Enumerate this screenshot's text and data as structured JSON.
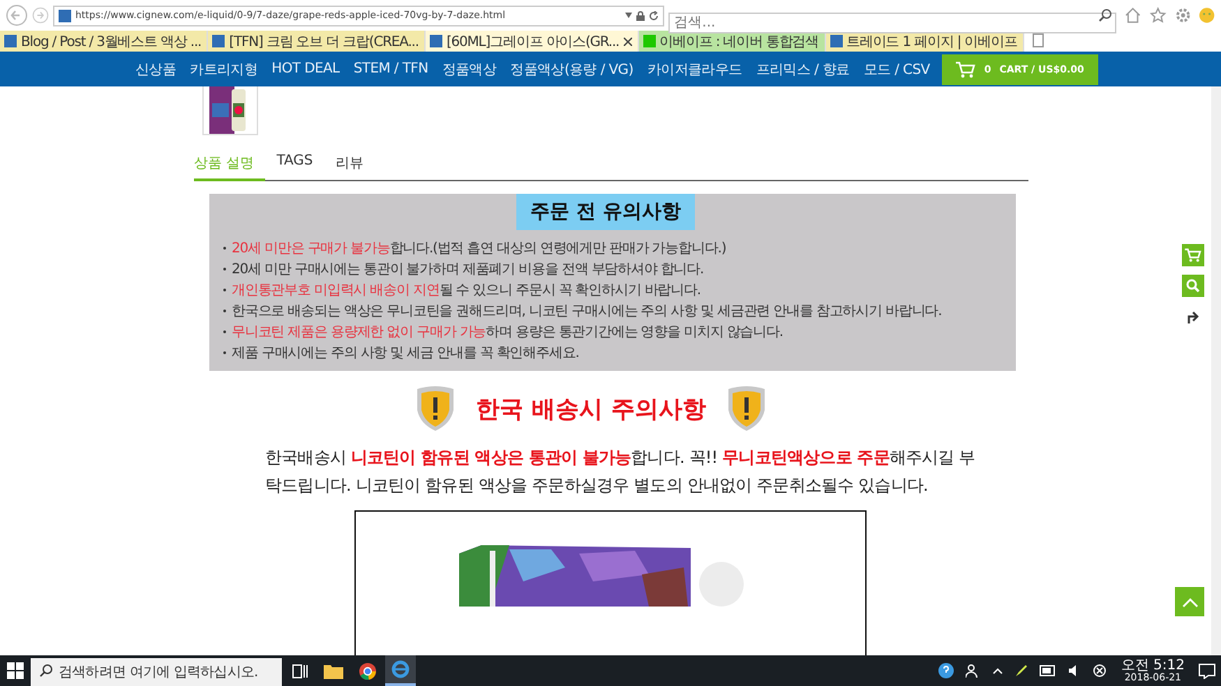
{
  "browser": {
    "address": "https://www.cignew.com/e-liquid/0-9/7-daze/grape-reds-apple-iced-70vg-by-7-daze.html",
    "search": {
      "placeholder": "검색..."
    },
    "tabs": [
      {
        "label": "Blog / Post / 3월베스트 액상 ...",
        "selected": false
      },
      {
        "label": "[TFN] 크림 오브 더 크랍(CREA...",
        "selected": false
      },
      {
        "label": "[60ML]그레이프 아이스(GR...",
        "selected": true
      },
      {
        "label": "이베이프 : 네이버 통합검색",
        "selected": false
      },
      {
        "label": "트레이드 1 페이지 | 이베이프",
        "selected": false
      }
    ]
  },
  "nav": {
    "items": [
      "신상품",
      "카트리지형",
      "HOT DEAL",
      "STEM / TFN",
      "정품액상",
      "정품액상(용량 / VG)",
      "카이저클라우드",
      "프리믹스 / 향료",
      "모드 / CSV"
    ],
    "cart": {
      "count": "0",
      "label": "CART / US$0.00"
    }
  },
  "product_tabs": [
    {
      "label": "상품 설명",
      "selected": true
    },
    {
      "label": "TAGS",
      "selected": false
    },
    {
      "label": "리뷰",
      "selected": false
    }
  ],
  "notice": {
    "title": "주문 전 유의사항",
    "lines": [
      [
        {
          "text": "20세 미만은 구매가 불가능",
          "highlight": true
        },
        {
          "text": "합니다.(법적 흡연 대상의 연령에게만 판매가 가능합니다.)",
          "highlight": false
        }
      ],
      [
        {
          "text": "20세 미만 구매시에는 통관이 불가하며 제품폐기 비용을 전액 부담하셔야 합니다.",
          "highlight": false
        }
      ],
      [
        {
          "text": "개인통관부호 미입력시 배송이 지연",
          "highlight": true
        },
        {
          "text": "될 수 있으니 주문시 꼭 확인하시기 바랍니다.",
          "highlight": false
        }
      ],
      [
        {
          "text": "한국으로 배송되는 액상은 무니코틴을 권해드리며, 니코틴 구매시에는 주의 사항 및 세금관련 안내를 참고하시기 바랍니다.",
          "highlight": false
        }
      ],
      [
        {
          "text": "무니코틴 제품은 용량제한 없이 구매가 가능",
          "highlight": true
        },
        {
          "text": "하며 용량은 통관기간에는 영향을 미치지 않습니다.",
          "highlight": false
        }
      ],
      [
        {
          "text": "제품 구매시에는 주의 사항 및 세금 안내를 꼭 확인해주세요.",
          "highlight": false
        }
      ]
    ]
  },
  "shipping": {
    "title": "한국 배송시 주의사항",
    "paragraph": [
      {
        "text": "한국배송시 ",
        "highlight": false
      },
      {
        "text": "니코틴이 함유된 액상은 통관이 불가능",
        "highlight": true
      },
      {
        "text": "합니다. 꼭!! ",
        "highlight": false
      },
      {
        "text": "무니코틴액상으로 주문",
        "highlight": true
      },
      {
        "text": "해주시길 부탁드립니다. 니코틴이 함유된 액상을 주문하실경우 별도의 안내없이 주문취소될수 있습니다.",
        "highlight": false
      }
    ]
  },
  "taskbar": {
    "search": {
      "placeholder": "검색하려면 여기에 입력하십시오."
    },
    "time": "오전 5:12",
    "date": "2018-06-21"
  }
}
